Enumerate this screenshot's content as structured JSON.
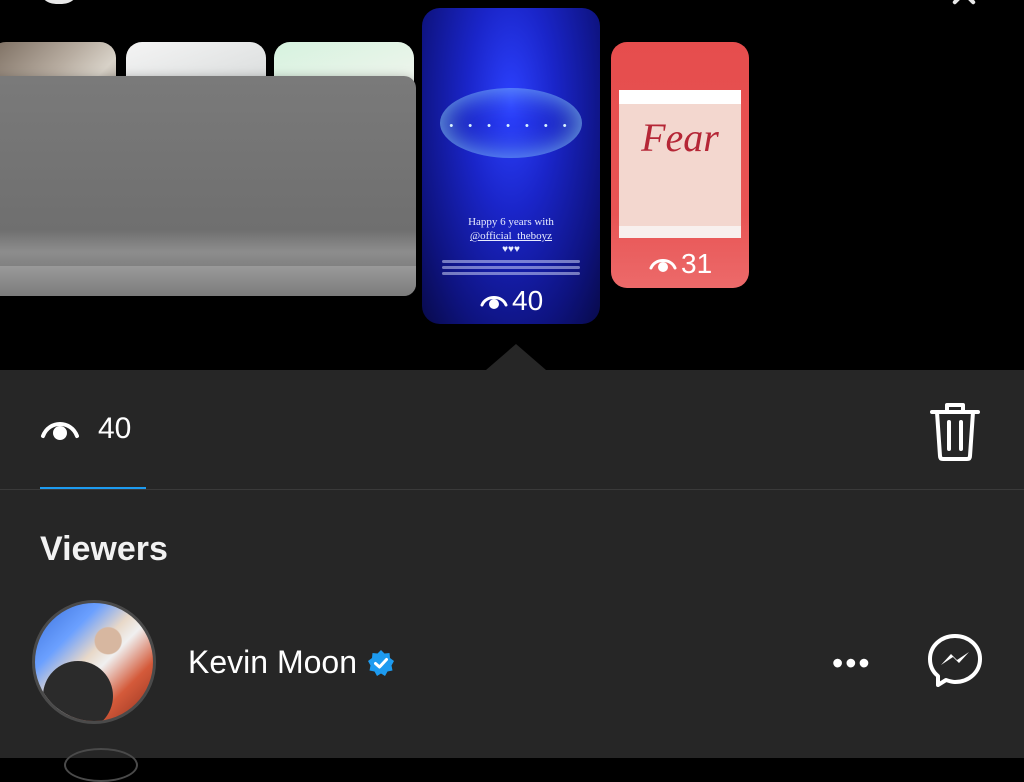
{
  "stories": {
    "active": {
      "views": "40",
      "lines": [
        "Happy 6 years with",
        "@official_theboyz",
        "♥♥♥"
      ]
    },
    "next": {
      "views": "31",
      "script_word": "Fear"
    }
  },
  "insights": {
    "view_count": "40"
  },
  "viewers_section": {
    "title": "Viewers",
    "list": [
      {
        "name": "Kevin Moon",
        "verified": true
      }
    ]
  },
  "colors": {
    "panel_bg": "#262626",
    "accent": "#1d9bf0",
    "verified_blue": "#1d9bf0"
  },
  "icons": {
    "views": "eye-icon",
    "delete": "trash-icon",
    "more": "more-icon",
    "message": "messenger-icon",
    "verified": "verified-badge-icon"
  }
}
